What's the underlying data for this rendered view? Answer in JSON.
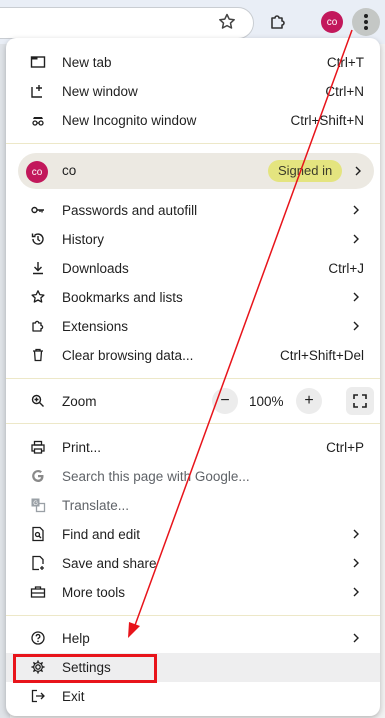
{
  "menu": {
    "items_group1": [
      {
        "label": "New tab",
        "shortcut": "Ctrl+T",
        "icon": "new-tab-icon"
      },
      {
        "label": "New window",
        "shortcut": "Ctrl+N",
        "icon": "new-window-icon"
      },
      {
        "label": "New Incognito window",
        "shortcut": "Ctrl+Shift+N",
        "icon": "incognito-icon"
      }
    ],
    "profile": {
      "avatar": "co",
      "name": "co",
      "status": "Signed in"
    },
    "items_group2": [
      {
        "label": "Passwords and autofill",
        "icon": "key-icon",
        "submenu": true
      },
      {
        "label": "History",
        "icon": "history-icon",
        "submenu": true
      },
      {
        "label": "Downloads",
        "shortcut": "Ctrl+J",
        "icon": "download-icon"
      },
      {
        "label": "Bookmarks and lists",
        "icon": "star-icon",
        "submenu": true
      },
      {
        "label": "Extensions",
        "icon": "puzzle-icon",
        "submenu": true
      },
      {
        "label": "Clear browsing data...",
        "shortcut": "Ctrl+Shift+Del",
        "icon": "trash-icon"
      }
    ],
    "zoom": {
      "label": "Zoom",
      "minus": "−",
      "value": "100%",
      "plus": "+"
    },
    "items_group3": [
      {
        "label": "Print...",
        "shortcut": "Ctrl+P",
        "icon": "print-icon"
      },
      {
        "label": "Search this page with Google...",
        "icon": "google-icon"
      },
      {
        "label": "Translate...",
        "icon": "translate-icon"
      },
      {
        "label": "Find and edit",
        "icon": "find-icon",
        "submenu": true
      },
      {
        "label": "Save and share",
        "icon": "save-icon",
        "submenu": true
      },
      {
        "label": "More tools",
        "icon": "toolbox-icon",
        "submenu": true
      }
    ],
    "items_group4": [
      {
        "label": "Help",
        "icon": "help-icon",
        "submenu": true
      },
      {
        "label": "Settings",
        "icon": "gear-icon"
      },
      {
        "label": "Exit",
        "icon": "exit-icon"
      }
    ]
  },
  "toolbar": {
    "avatar": "co"
  },
  "colors": {
    "accent": "#c2185b",
    "signed_in_badge": "#e4e47f",
    "annotation": "#e8141b"
  }
}
